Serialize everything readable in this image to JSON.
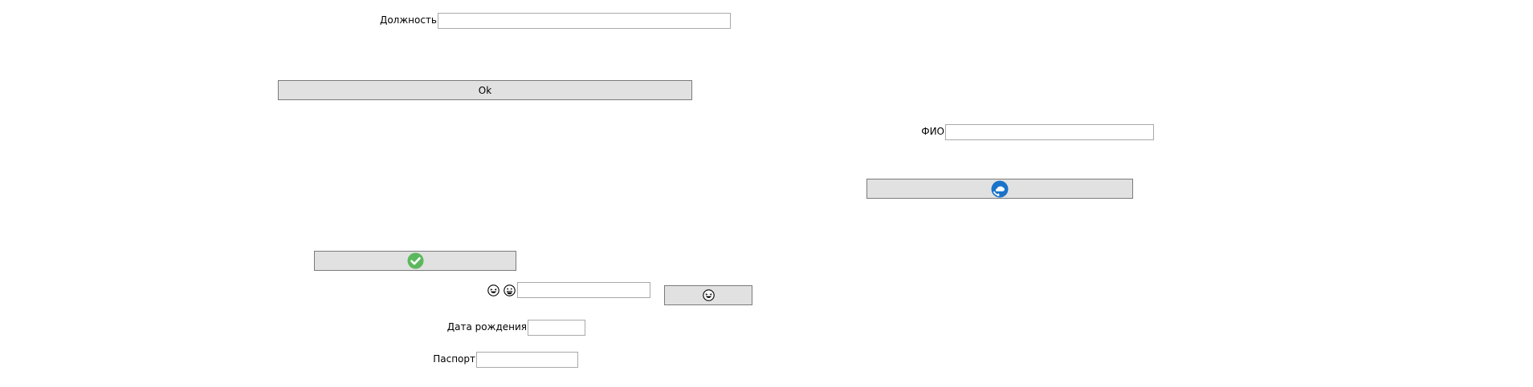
{
  "form": {
    "position_label": "Должность",
    "position_value": "",
    "ok_label": "Ok",
    "fio_label": "ФИО",
    "fio_value": "",
    "birthdate_label": "Дата рождения",
    "birthdate_value": "",
    "passport_label": "Паспорт",
    "passport_value": "",
    "emoji_field_value": ""
  },
  "icons": {
    "cloud_button_icon": "cloud-refresh-icon",
    "check_button_icon": "check-circle-icon",
    "emoji_left": "laughing-face-icon",
    "emoji_right": "grinning-face-icon",
    "emoji_button_icon": "laughing-face-icon"
  },
  "colors": {
    "button_bg": "#e1e1e1",
    "button_border": "#7a7a7a",
    "field_border": "#a9a9a9",
    "check_green": "#5cb85c",
    "cloud_blue": "#1a73c9"
  }
}
